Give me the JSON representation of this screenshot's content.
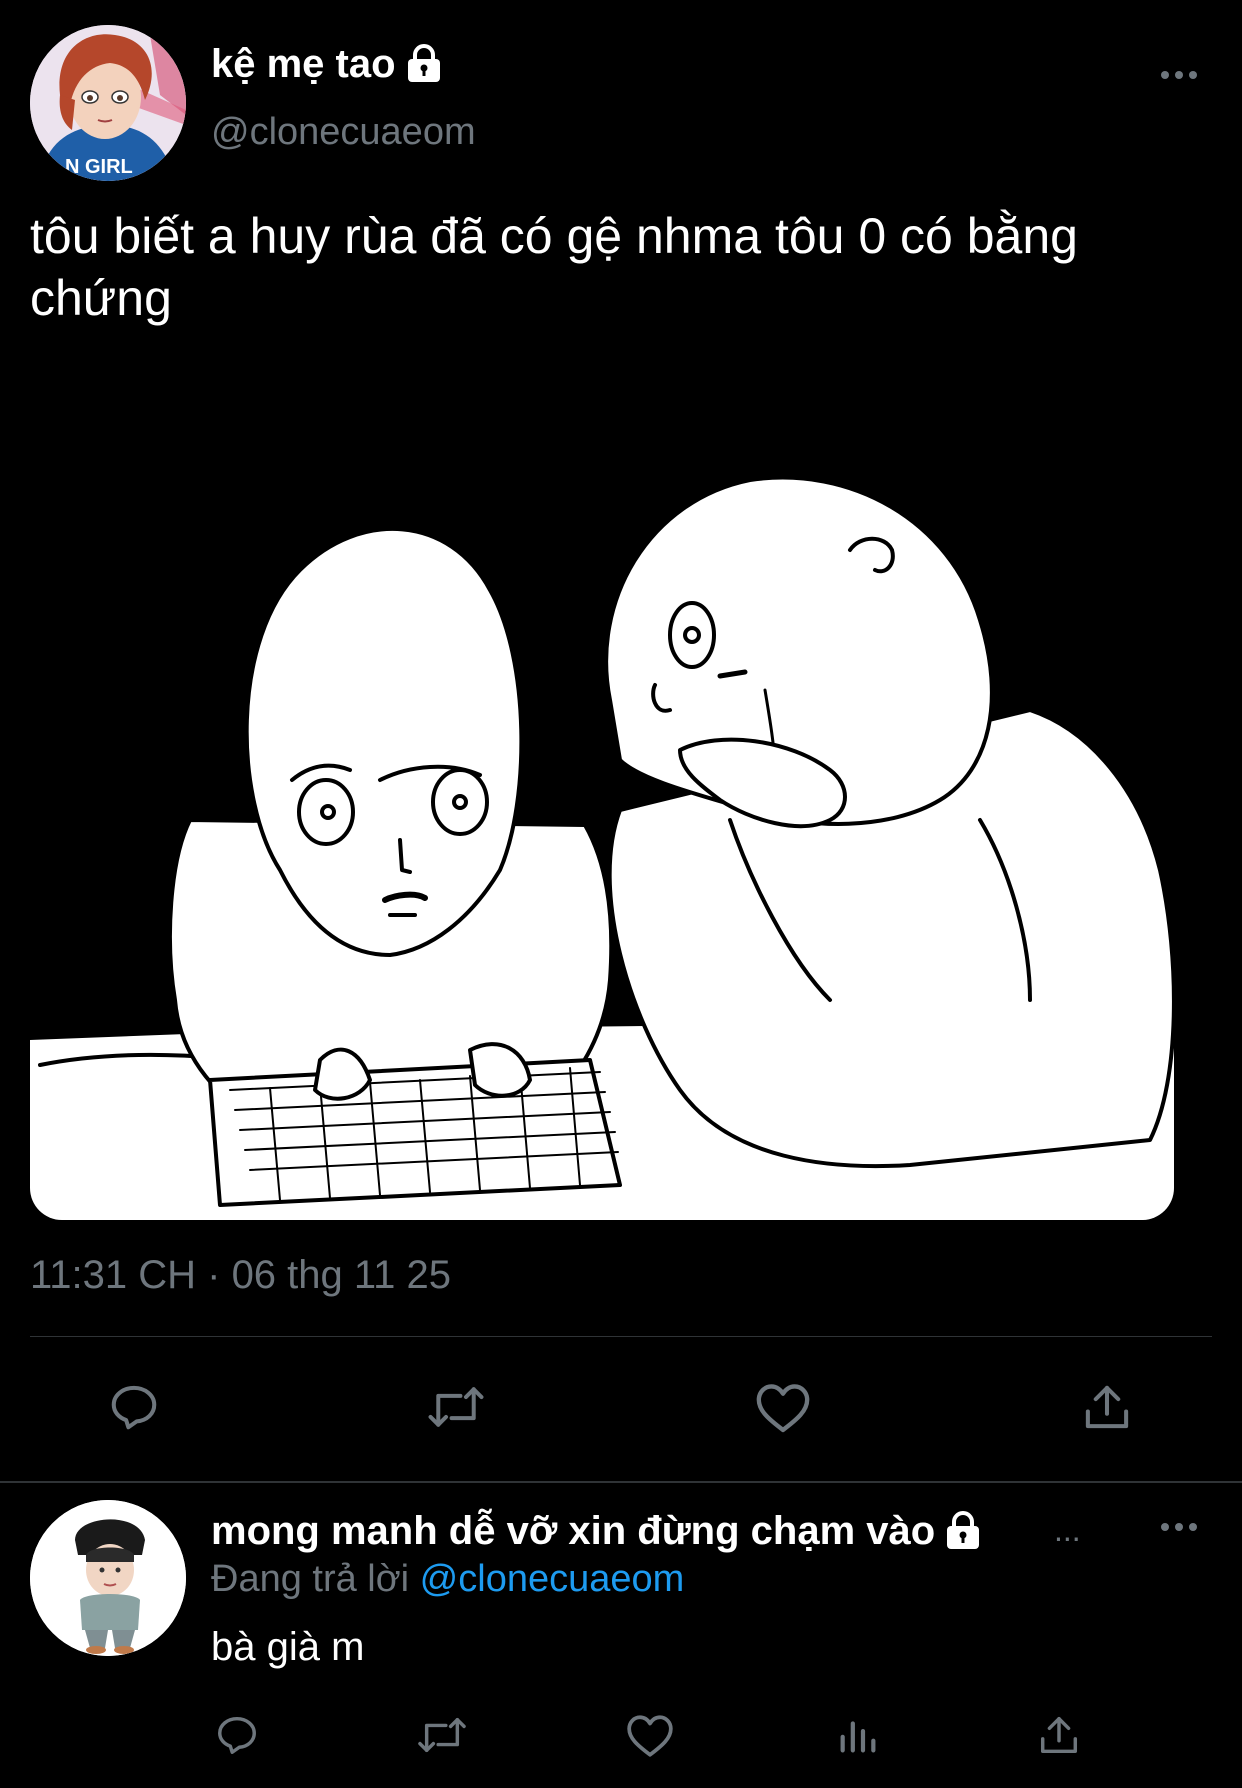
{
  "main_tweet": {
    "display_name": "kệ mẹ tao",
    "handle": "@clonecuaeom",
    "text": "tôu biết a huy rùa đã có gệ nhma tôu 0 có bằng chứng",
    "timestamp": "11:31 CH · 06 thg 11 25",
    "avatar_shirt_text": "N GIRL",
    "actions": [
      "reply-icon",
      "retweet-icon",
      "like-icon",
      "share-icon"
    ]
  },
  "reply_tweet": {
    "display_name": "mong manh dễ vỡ xin đừng chạm vào",
    "truncation": "...",
    "replying_to_label": "Đang trả lời",
    "replying_to_handle": "@clonecuaeom",
    "text": "bà già m",
    "actions": [
      "reply-icon",
      "retweet-icon",
      "like-icon",
      "analytics-icon",
      "share-icon"
    ]
  },
  "colors": {
    "background": "#000000",
    "text_primary": "#ffffff",
    "text_secondary": "#6e767d",
    "link": "#1d9bf0",
    "divider": "#2f3336"
  }
}
